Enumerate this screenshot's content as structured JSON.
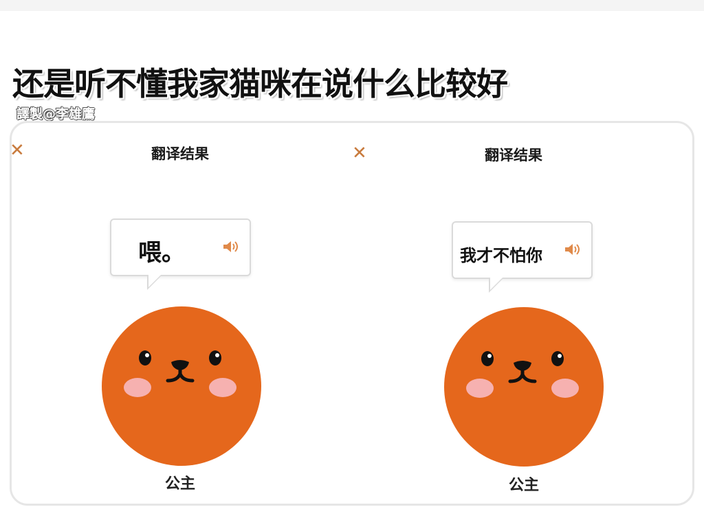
{
  "meme": {
    "title": "还是听不懂我家猫咪在说什么比较好",
    "credit": "譯製@李雄鷹"
  },
  "panels": [
    {
      "close_glyph": "✕",
      "title": "翻译结果",
      "speech": "喂。",
      "speaker_icon": "speaker-icon",
      "name": "公主"
    },
    {
      "close_glyph": "✕",
      "title": "翻译结果",
      "speech": "我才不怕你",
      "speaker_icon": "speaker-icon",
      "name": "公主"
    }
  ],
  "colors": {
    "cat_orange": "#e5671c",
    "close_orange": "#c87a3c",
    "cheek_pink": "#f6b1b0"
  }
}
